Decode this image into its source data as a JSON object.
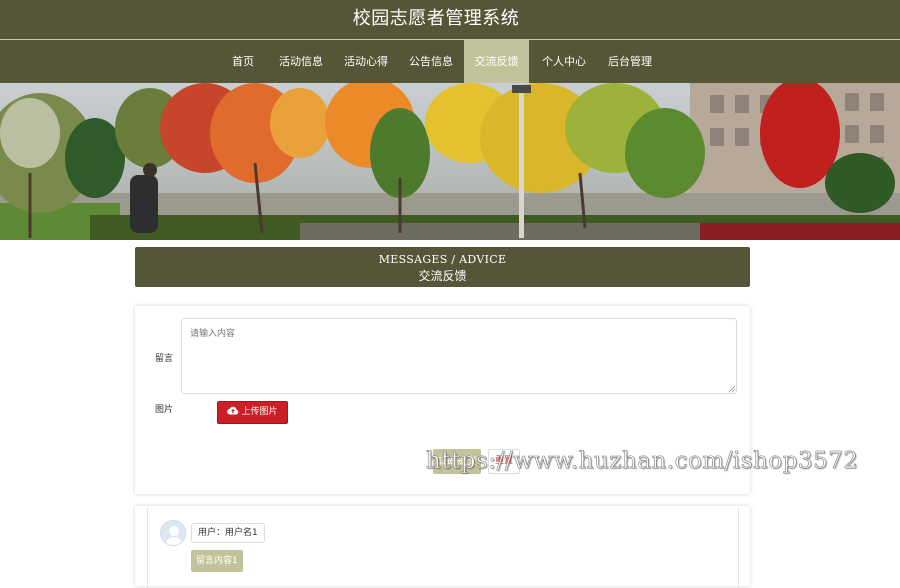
{
  "header": {
    "title": "校园志愿者管理系统"
  },
  "nav": {
    "items": [
      {
        "label": "首页"
      },
      {
        "label": "活动信息"
      },
      {
        "label": "活动心得"
      },
      {
        "label": "公告信息"
      },
      {
        "label": "交流反馈"
      },
      {
        "label": "个人中心"
      },
      {
        "label": "后台管理"
      }
    ],
    "active": "交流反馈"
  },
  "section": {
    "title_en": "MESSAGES / ADVICE",
    "title_cn": "交流反馈"
  },
  "form": {
    "message_label": "留言",
    "message_placeholder": "请输入内容",
    "image_label": "图片",
    "upload_label": "上传图片",
    "submit_label": "立即提交",
    "reset_label": "重置"
  },
  "watermark": "https://www.huzhan.com/ishop3572",
  "messages": [
    {
      "user_text": "用户：用户名1",
      "content_text": "留言内容1"
    }
  ],
  "colors": {
    "header_bg": "#555638",
    "nav_active": "#c2c39a",
    "upload_btn": "#c91f25",
    "submit_btn": "#c2c39a"
  },
  "icons": {
    "upload": "cloud-upload-icon",
    "avatar": "user-avatar-icon"
  }
}
